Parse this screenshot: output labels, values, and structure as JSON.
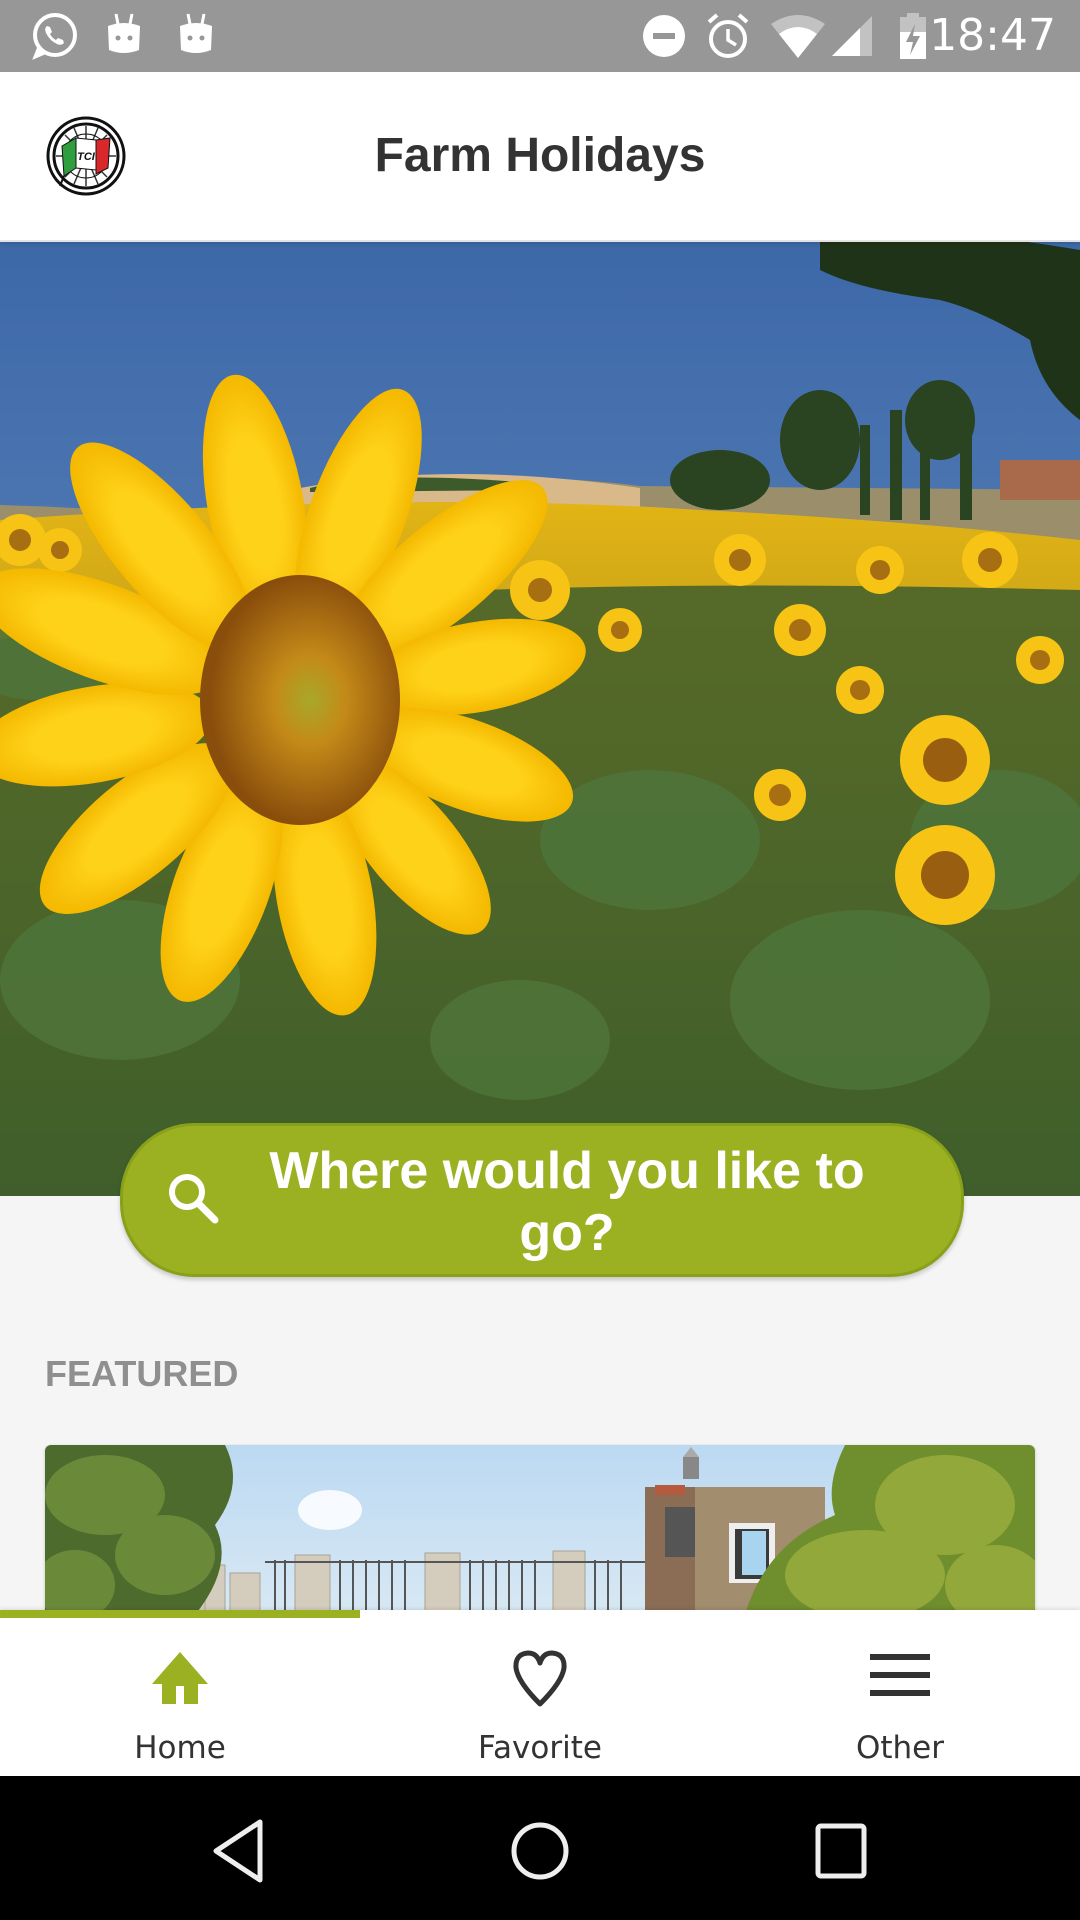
{
  "status_bar": {
    "time": "18:47",
    "left_icons": [
      "whatsapp-icon",
      "android-icon",
      "android-icon"
    ],
    "right_icons": [
      "do-not-disturb-icon",
      "alarm-icon",
      "wifi-icon",
      "signal-icon",
      "battery-charging-icon"
    ]
  },
  "app_bar": {
    "title": "Farm Holidays",
    "logo": "tci-logo"
  },
  "hero": {
    "image": "sunflower-field"
  },
  "search": {
    "icon": "search-icon",
    "label": "Where would you like to go?"
  },
  "featured": {
    "label": "FEATURED",
    "cards": [
      {
        "image": "stone-farmhouse-with-fence"
      }
    ]
  },
  "bottom_nav": {
    "active_index": 0,
    "items": [
      {
        "label": "Home",
        "icon": "home-icon"
      },
      {
        "label": "Favorite",
        "icon": "heart-icon"
      },
      {
        "label": "Other",
        "icon": "menu-icon"
      }
    ]
  },
  "system_nav": {
    "buttons": [
      "back-icon",
      "home-circle-icon",
      "recents-icon"
    ]
  },
  "colors": {
    "accent": "#9bb122",
    "status_bar": "#979797",
    "title_text": "#333333",
    "section_label": "#8f8f8f"
  }
}
